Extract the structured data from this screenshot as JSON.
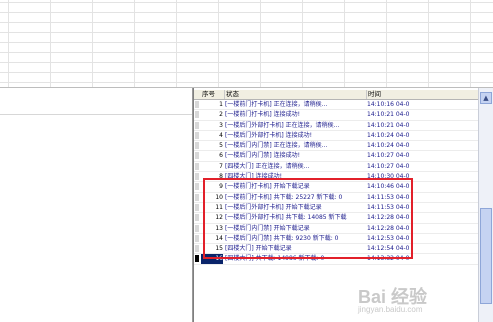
{
  "table": {
    "columns": {
      "seq": "序号",
      "status": "状态",
      "time": "时间"
    },
    "rows": [
      {
        "seq": "1",
        "status": "[一楼前门打卡机] 正在连接，请稍侯...",
        "time": "14:10:16 04-0"
      },
      {
        "seq": "2",
        "status": "[一楼前门打卡机] 连接成功!",
        "time": "14:10:21 04-0"
      },
      {
        "seq": "3",
        "status": "[一楼后门外部打卡机] 正在连接，请稍侯...",
        "time": "14:10:21 04-0"
      },
      {
        "seq": "4",
        "status": "[一楼后门外部打卡机] 连接成功!",
        "time": "14:10:24 04-0"
      },
      {
        "seq": "5",
        "status": "[一楼后门内门禁] 正在连接，请稍侯...",
        "time": "14:10:24 04-0"
      },
      {
        "seq": "6",
        "status": "[一楼后门内门禁] 连接成功!",
        "time": "14:10:27 04-0"
      },
      {
        "seq": "7",
        "status": "[四楼大门] 正在连接，请稍侯...",
        "time": "14:10:27 04-0"
      },
      {
        "seq": "8",
        "status": "[四楼大门] 连接成功!",
        "time": "14:10:30 04-0"
      },
      {
        "seq": "9",
        "status": "[一楼前门打卡机] 开始下载记录",
        "time": "14:10:46 04-0"
      },
      {
        "seq": "10",
        "status": "[一楼前门打卡机] 共下载: 25227 新下载: 0",
        "time": "14:11:53 04-0"
      },
      {
        "seq": "11",
        "status": "[一楼后门外部打卡机] 开始下载记录",
        "time": "14:11:53 04-0"
      },
      {
        "seq": "12",
        "status": "[一楼后门外部打卡机] 共下载: 14085 新下载",
        "time": "14:12:28 04-0"
      },
      {
        "seq": "13",
        "status": "[一楼后门内门禁] 开始下载记录",
        "time": "14:12:28 04-0"
      },
      {
        "seq": "14",
        "status": "[一楼后门内门禁] 共下载: 9230 新下载: 0",
        "time": "14:12:53 04-0"
      },
      {
        "seq": "15",
        "status": "[四楼大门] 开始下载记录",
        "time": "14:12:54 04-0"
      },
      {
        "seq": "16",
        "status": "[四楼大门] 共下载: 14986 新下载: 0",
        "time": "14:13:32 04-0"
      }
    ]
  },
  "watermark": {
    "text": "Bai 经验",
    "sub": "jingyan.baidu.com"
  },
  "colors": {
    "highlight": "#e2202a",
    "selection": "#0a246a",
    "row_text": "#1a1a8c"
  }
}
